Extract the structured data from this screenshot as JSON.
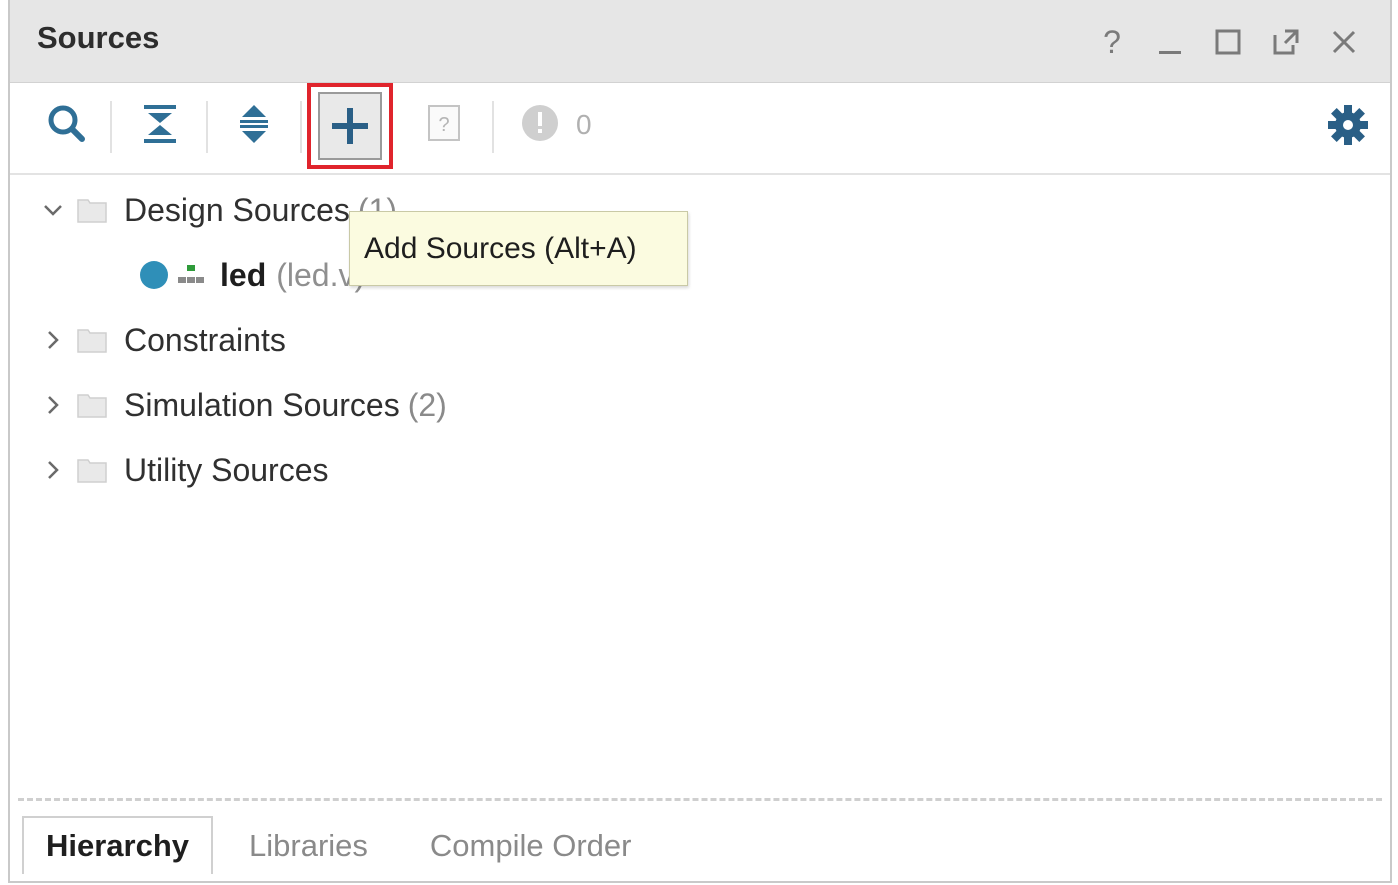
{
  "panel": {
    "title": "Sources",
    "window_controls": [
      {
        "name": "help",
        "glyph": "?"
      },
      {
        "name": "minimize",
        "glyph": "_"
      },
      {
        "name": "maximize",
        "glyph": "□"
      },
      {
        "name": "float",
        "glyph": "⧉"
      },
      {
        "name": "close",
        "glyph": "✕"
      }
    ]
  },
  "toolbar": {
    "search": "search-icon",
    "collapse_all": "collapse-all-icon",
    "expand_all": "expand-all-icon",
    "add_sources": "plus-icon",
    "unknown": "question-doc-icon",
    "status_count": "0",
    "settings": "gear-icon"
  },
  "tooltip": {
    "text": "Add Sources (Alt+A)"
  },
  "tree": {
    "design_sources": {
      "label": "Design Sources",
      "count": "(1)"
    },
    "led": {
      "label": "led",
      "file": "(led.v)"
    },
    "constraints": {
      "label": "Constraints"
    },
    "simulation_sources": {
      "label": "Simulation Sources",
      "count": "(2)"
    },
    "utility_sources": {
      "label": "Utility Sources"
    }
  },
  "tabs": [
    {
      "label": "Hierarchy",
      "active": true
    },
    {
      "label": "Libraries",
      "active": false
    },
    {
      "label": "Compile Order",
      "active": false
    }
  ],
  "colors": {
    "highlight": "#e0242c",
    "tooltip_bg": "#fbfbe0",
    "accent_blue": "#2f7da8",
    "status_green": "#2e9b3a"
  }
}
